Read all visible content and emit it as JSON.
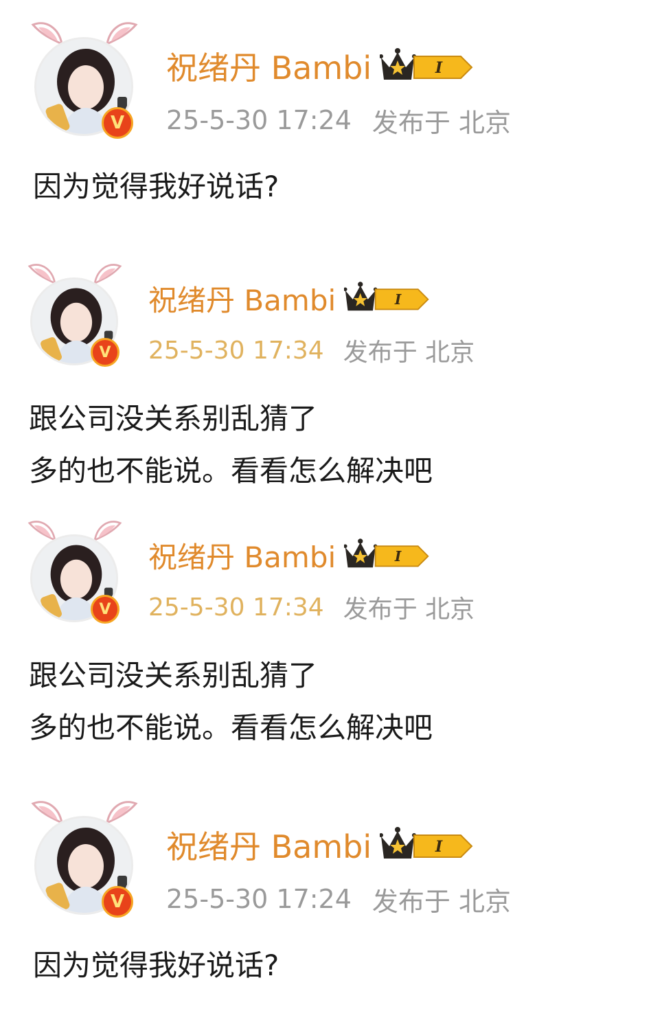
{
  "posts": [
    {
      "username": "祝绪丹 Bambi",
      "level": "I",
      "timestamp": "25-5-30 17:24",
      "location": "发布于 北京",
      "lines": [
        "因为觉得我好说话?"
      ]
    },
    {
      "username": "祝绪丹 Bambi",
      "level": "I",
      "timestamp": "25-5-30 17:34",
      "location": "发布于 北京",
      "lines": [
        "跟公司没关系别乱猜了",
        "多的也不能说。看看怎么解决吧"
      ]
    },
    {
      "username": "祝绪丹 Bambi",
      "level": "I",
      "timestamp": "25-5-30 17:34",
      "location": "发布于 北京",
      "lines": [
        "跟公司没关系别乱猜了",
        "多的也不能说。看看怎么解决吧"
      ]
    },
    {
      "username": "祝绪丹 Bambi",
      "level": "I",
      "timestamp": "25-5-30 17:24",
      "location": "发布于 北京",
      "lines": [
        "因为觉得我好说话?"
      ]
    }
  ],
  "verified_badge": "V",
  "icons": {
    "avatar_frame": "bunny-ears-icon",
    "verified": "verified-v-icon",
    "membership": "crown-level-icon"
  },
  "colors": {
    "username": "#e08a2c",
    "meta": "#9a9a9a",
    "body": "#1a1a1a",
    "verified": "#e8431a",
    "crown_gold": "#f6b81c"
  }
}
